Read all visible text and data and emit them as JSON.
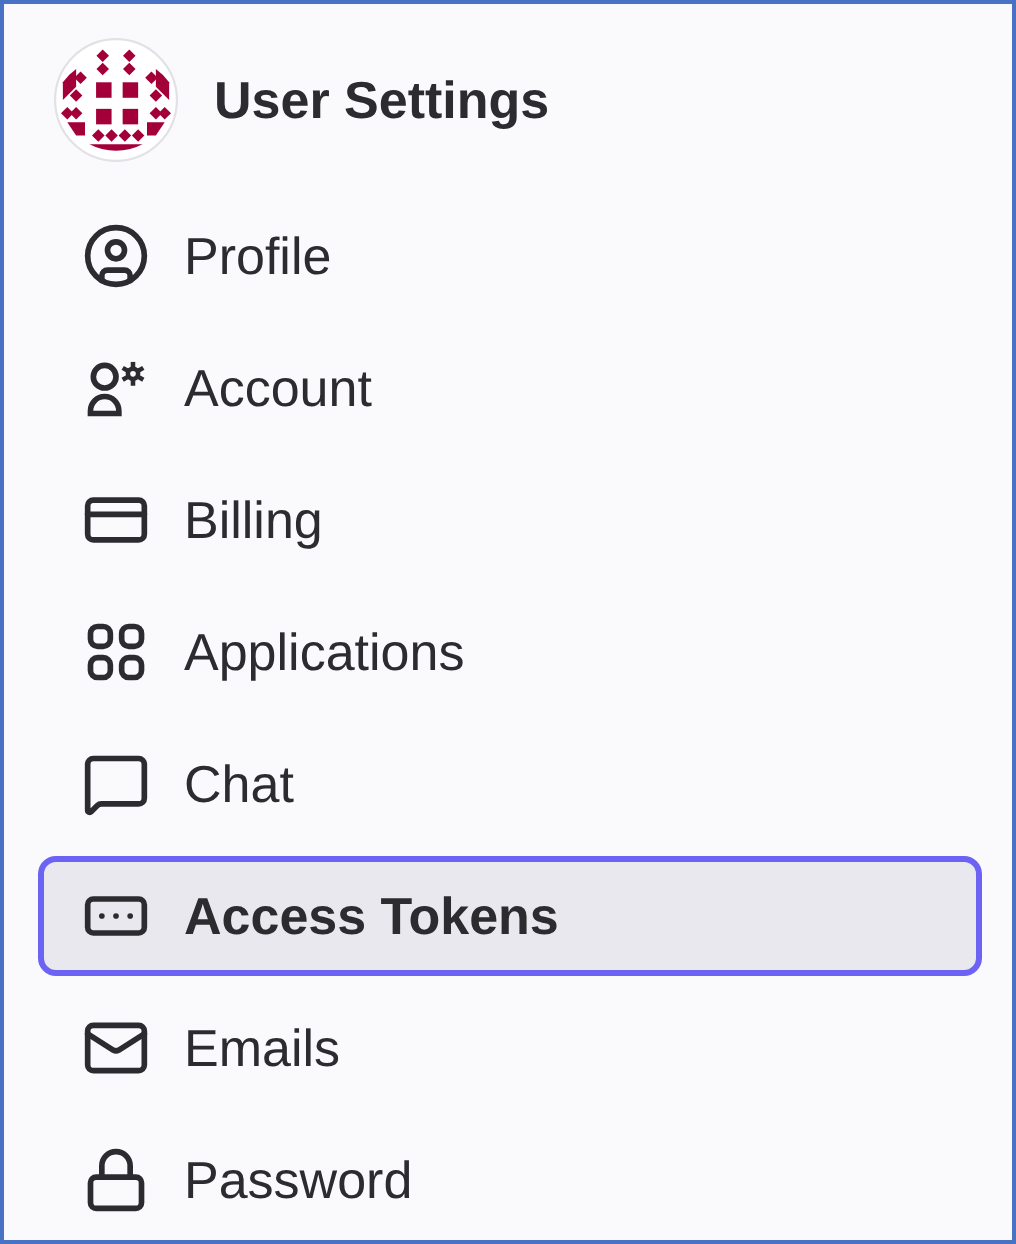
{
  "header": {
    "title": "User Settings"
  },
  "nav": [
    {
      "label": "Profile",
      "kind": "profile",
      "selected": false
    },
    {
      "label": "Account",
      "kind": "account",
      "selected": false
    },
    {
      "label": "Billing",
      "kind": "billing",
      "selected": false
    },
    {
      "label": "Applications",
      "kind": "applications",
      "selected": false
    },
    {
      "label": "Chat",
      "kind": "chat",
      "selected": false
    },
    {
      "label": "Access Tokens",
      "kind": "tokens",
      "selected": true
    },
    {
      "label": "Emails",
      "kind": "emails",
      "selected": false
    },
    {
      "label": "Password",
      "kind": "password",
      "selected": false
    }
  ]
}
